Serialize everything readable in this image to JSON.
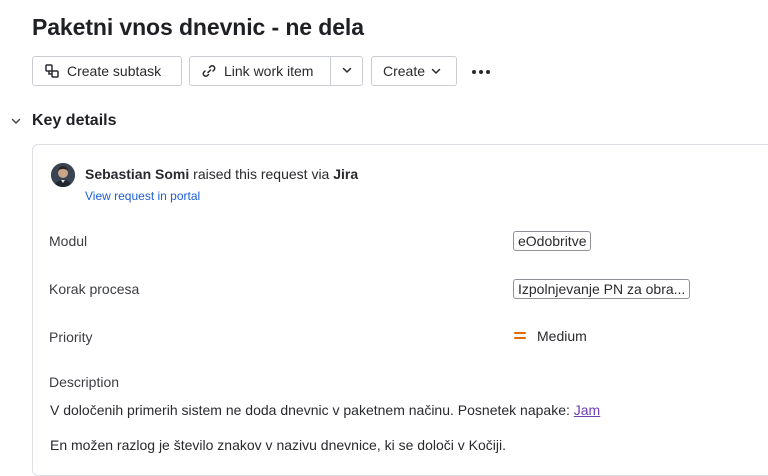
{
  "issue": {
    "title": "Paketni vnos dnevnic - ne dela"
  },
  "toolbar": {
    "create_subtask_label": "Create subtask",
    "link_work_item_label": "Link work item",
    "create_label": "Create"
  },
  "key_details": {
    "heading": "Key details",
    "requester": {
      "name": "Sebastian Somi",
      "raised_text": "raised this request via",
      "channel": "Jira",
      "portal_link": "View request in portal"
    },
    "fields": {
      "modul": {
        "label": "Modul",
        "value": "eOdobritve"
      },
      "korak": {
        "label": "Korak procesa",
        "value": "Izpolnjevanje PN za obra..."
      },
      "priority": {
        "label": "Priority",
        "value": "Medium",
        "color": "#e06c00"
      }
    },
    "description": {
      "label": "Description",
      "line1": "V določenih primerih sistem ne doda dnevnic v paketnem načinu. Posnetek napake:",
      "line1_link": "Jam",
      "line2": "En možen razlog je število znakov v nazivu dnevnice, ki se določi v Kočiji."
    }
  },
  "icons": {
    "subtask": "subtask-icon",
    "link": "link-icon",
    "chevron": "chevron-down-icon",
    "more": "more-horizontal-icon",
    "priority": "priority-medium-icon"
  }
}
